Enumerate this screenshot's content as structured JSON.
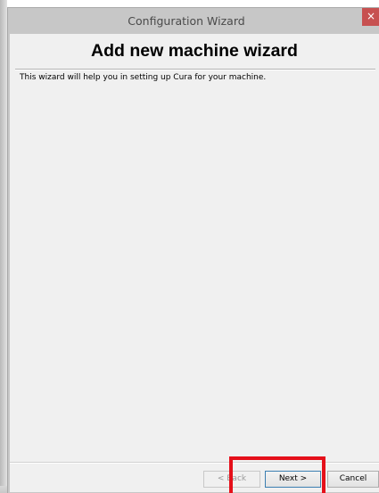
{
  "window": {
    "title": "Configuration Wizard",
    "close_icon": "close-icon",
    "close_glyph": "×"
  },
  "wizard": {
    "heading": "Add new machine wizard",
    "intro": "This wizard will help you in setting up Cura for your machine."
  },
  "buttons": {
    "back_label": "< Back",
    "next_label": "Next >",
    "cancel_label": "Cancel"
  },
  "colors": {
    "highlight": "#e5101a",
    "close_button": "#c75050",
    "titlebar": "#c7c7c7"
  }
}
